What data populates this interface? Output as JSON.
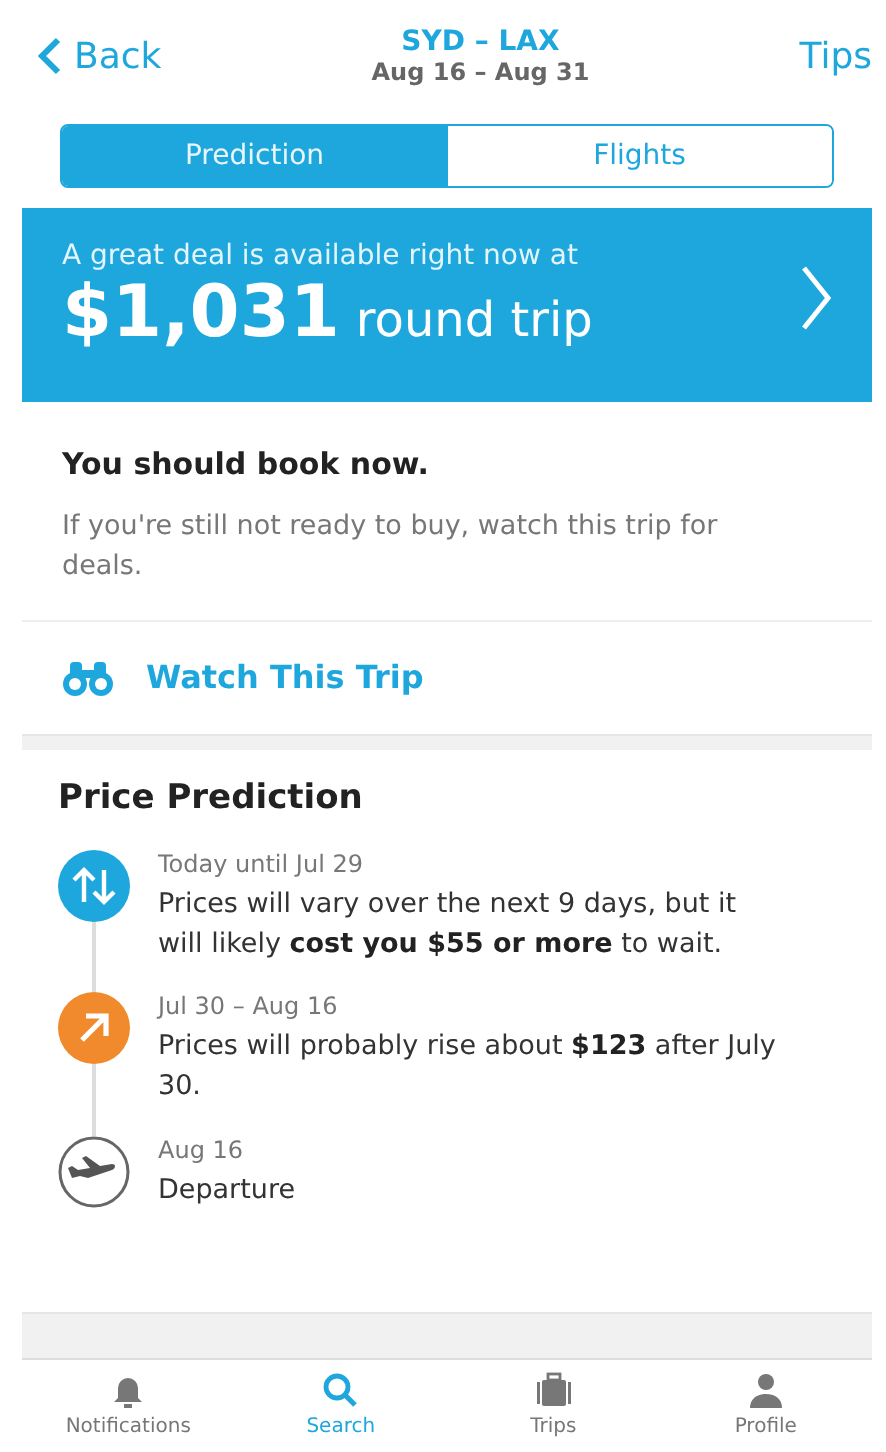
{
  "header": {
    "back": "Back",
    "route": "SYD – LAX",
    "dates": "Aug 16 – Aug 31",
    "tips": "Tips"
  },
  "tabs": [
    {
      "label": "Prediction",
      "selected": true
    },
    {
      "label": "Flights",
      "selected": false
    }
  ],
  "deal": {
    "intro": "A great deal is available right now at",
    "price": "$1,031",
    "suffix": "round trip"
  },
  "advice": {
    "title": "You should book now.",
    "text": "If you're still not ready to buy, watch this trip for deals."
  },
  "watch": {
    "label": "Watch This Trip"
  },
  "prediction": {
    "title": "Price Prediction",
    "items": [
      {
        "kind": "vary",
        "color": "#1ea7dd",
        "period": "Today until Jul 29",
        "text": "Prices will vary over the next 9 days, but it will likely **cost you $55 or more** to wait."
      },
      {
        "kind": "rise",
        "color": "#f08a2c",
        "period": "Jul 30 – Aug 16",
        "text": "Prices will probably rise about **$123** after July 30."
      },
      {
        "kind": "departure",
        "period": "Aug 16",
        "text": "Departure"
      }
    ]
  },
  "tab_bar": [
    {
      "kind": "bell",
      "label": "Notifications",
      "selected": false
    },
    {
      "kind": "search",
      "label": "Search",
      "selected": true
    },
    {
      "kind": "luggage",
      "label": "Trips",
      "selected": false
    },
    {
      "kind": "person",
      "label": "Profile",
      "selected": false
    }
  ]
}
